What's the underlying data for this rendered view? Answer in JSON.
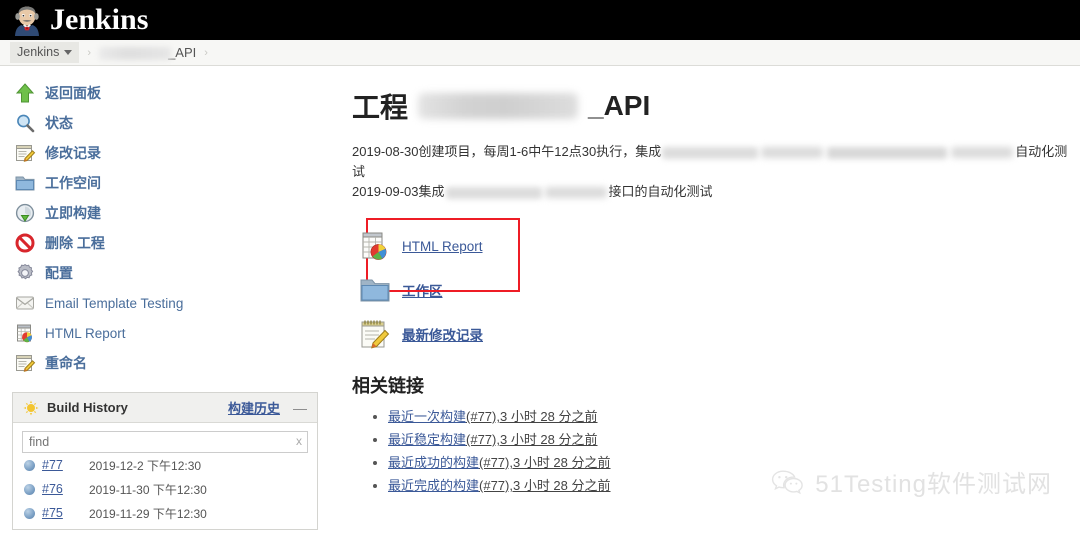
{
  "header": {
    "brand": "Jenkins",
    "logo_icon": "jenkins-butler-icon"
  },
  "breadcrumb": {
    "root": "Jenkins",
    "project_suffix": "_API",
    "separator": "›"
  },
  "sidebar": {
    "tasks": [
      {
        "label": "返回面板",
        "icon": "up-arrow-icon",
        "cn": true
      },
      {
        "label": "状态",
        "icon": "magnifier-icon",
        "cn": true
      },
      {
        "label": "修改记录",
        "icon": "notepad-pencil-icon",
        "cn": true
      },
      {
        "label": "工作空间",
        "icon": "folder-icon",
        "cn": true
      },
      {
        "label": "立即构建",
        "icon": "build-now-icon",
        "cn": true
      },
      {
        "label": "删除 工程",
        "icon": "delete-forbidden-icon",
        "cn": true
      },
      {
        "label": "配置",
        "icon": "gear-icon",
        "cn": true
      },
      {
        "label": "Email Template Testing",
        "icon": "envelope-icon",
        "cn": false
      },
      {
        "label": "HTML Report",
        "icon": "html-report-icon",
        "cn": false
      },
      {
        "label": "重命名",
        "icon": "notepad-pencil-icon",
        "cn": true
      }
    ],
    "build_history": {
      "title": "Build History",
      "title_cn": "构建历史",
      "collapse_icon": "—",
      "weather_icon": "sun-icon",
      "find_placeholder": "find",
      "clear_label": "x",
      "builds": [
        {
          "number": "#77",
          "date": "2019-12-2 下午12:30"
        },
        {
          "number": "#76",
          "date": "2019-11-30 下午12:30"
        },
        {
          "number": "#75",
          "date": "2019-11-29 下午12:30"
        }
      ]
    }
  },
  "main": {
    "title_prefix": "工程",
    "title_suffix": "_API",
    "description_lines": [
      {
        "pre": "2019-08-30创建项目，每周1-6中午12点30执行，集成",
        "post": "自动化测试"
      },
      {
        "pre": "2019-09-03集成",
        "post": "接口的自动化测试"
      }
    ],
    "actions": [
      {
        "label": "HTML Report",
        "icon": "html-report-icon",
        "cn": false,
        "highlighted": true
      },
      {
        "label": "工作区",
        "icon": "folder-icon",
        "cn": true,
        "highlighted": false
      },
      {
        "label": "最新修改记录",
        "icon": "notepad-pencil-icon",
        "cn": true,
        "highlighted": false
      }
    ],
    "related": {
      "title": "相关链接",
      "items": [
        {
          "link": "最近一次构建",
          "meta": "(#77),3 小时 28 分之前"
        },
        {
          "link": "最近稳定构建",
          "meta": "(#77),3 小时 28 分之前"
        },
        {
          "link": "最近成功的构建",
          "meta": "(#77),3 小时 28 分之前"
        },
        {
          "link": "最近完成的构建",
          "meta": "(#77),3 小时 28 分之前"
        }
      ]
    }
  },
  "watermark": {
    "text": "51Testing软件测试网",
    "icon": "wechat-icon"
  },
  "colors": {
    "topbar": "#000000",
    "link": "#3b5998",
    "highlight_box": "#ee1c25",
    "panel_header": "#f0f0ee"
  }
}
